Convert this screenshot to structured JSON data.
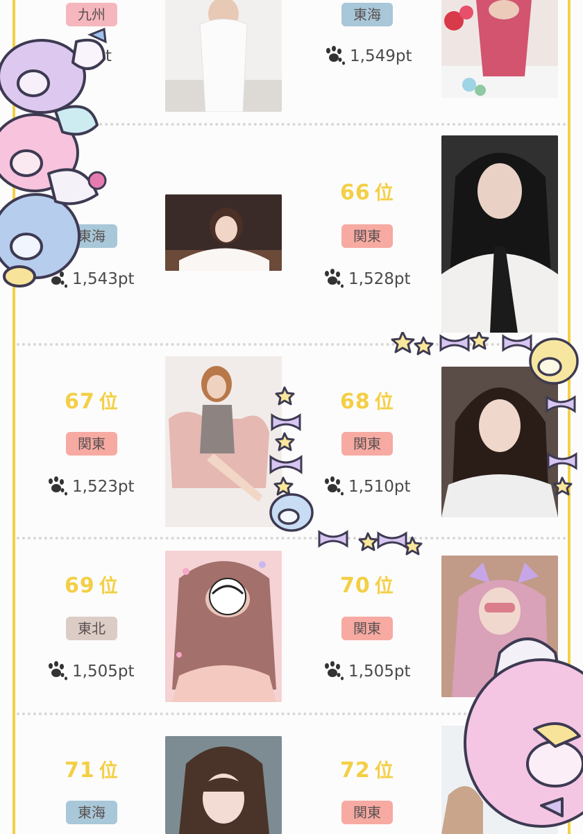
{
  "colors": {
    "rank_yellow": "#f3cf45",
    "frame_yellow": "#f3cf45",
    "region": {
      "kyushu": "#f6b6bd",
      "tokai": "#a8c7d8",
      "kanto": "#f6aaa2",
      "tohoku": "#dcccc6"
    }
  },
  "rank_unit": "位",
  "entries": [
    {
      "rank": "",
      "region": "九州",
      "points": "51pt",
      "photo": "white-dress-photo"
    },
    {
      "rank": "",
      "region": "東海",
      "points": "1,549pt",
      "photo": "pink-dress-photo"
    },
    {
      "rank": "",
      "region": "東海",
      "points": "1,543pt",
      "photo": "dark-room-photo"
    },
    {
      "rank": "66",
      "region": "関東",
      "points": "1,528pt",
      "photo": "tie-selfie-photo"
    },
    {
      "rank": "67",
      "region": "関東",
      "points": "1,523pt",
      "photo": "armchair-photo"
    },
    {
      "rank": "68",
      "region": "関東",
      "points": "1,510pt",
      "photo": "wavy-hair-photo"
    },
    {
      "rank": "69",
      "region": "東北",
      "points": "1,505pt",
      "photo": "pink-sticker-photo"
    },
    {
      "rank": "70",
      "region": "関東",
      "points": "1,505pt",
      "photo": "cat-ears-photo"
    },
    {
      "rank": "71",
      "region": "東海",
      "points": "",
      "photo": "bangs-photo"
    },
    {
      "rank": "72",
      "region": "関東",
      "points": "",
      "photo": "bright-photo"
    }
  ],
  "icons": {
    "points": "paw-icon",
    "stickers": [
      "penguin-sticker",
      "star-sticker",
      "ribbon-sticker"
    ]
  }
}
